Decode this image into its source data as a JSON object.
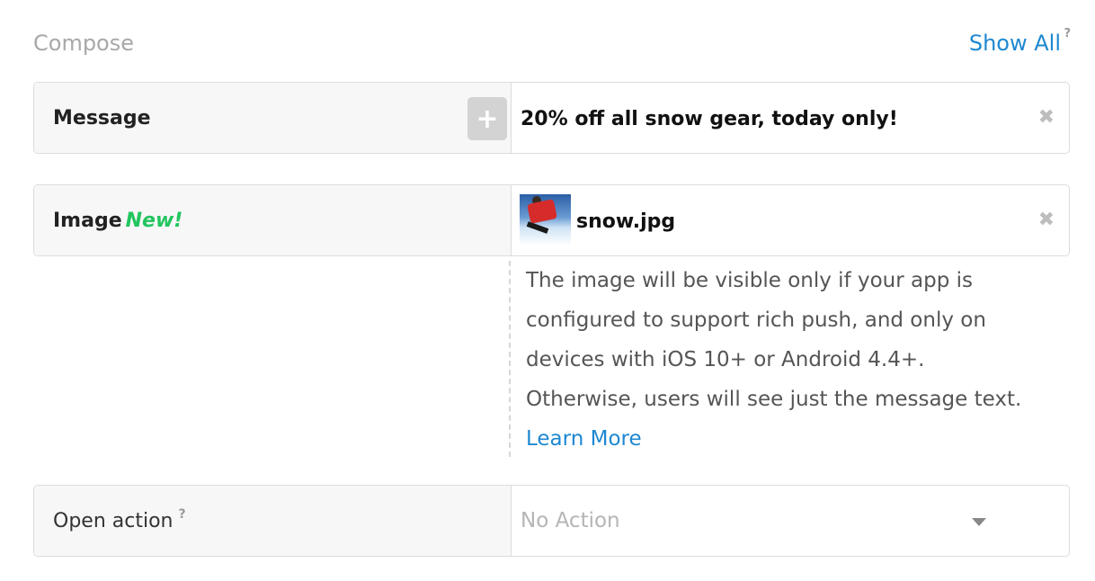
{
  "header": {
    "title": "Compose",
    "show_all_label": "Show All",
    "help_mark": "?"
  },
  "message_row": {
    "label": "Message",
    "add_icon": "+",
    "value": "20% off all snow gear, today only!",
    "clear_icon": "✖"
  },
  "image_row": {
    "label": "Image",
    "badge": "New!",
    "file_name": "snow.jpg",
    "clear_icon": "✖"
  },
  "image_note": {
    "text": "The image will be visible only if your app is configured to support rich push, and only on devices with iOS 10+ or Android 4.4+. Otherwise, users will see just the message text. ",
    "link_label": "Learn More"
  },
  "open_action_row": {
    "label": "Open action",
    "help_mark": "?",
    "placeholder": "No Action"
  },
  "colors": {
    "accent": "#1e88d1",
    "new_badge": "#22c55e",
    "placeholder": "#b5b5b5"
  }
}
